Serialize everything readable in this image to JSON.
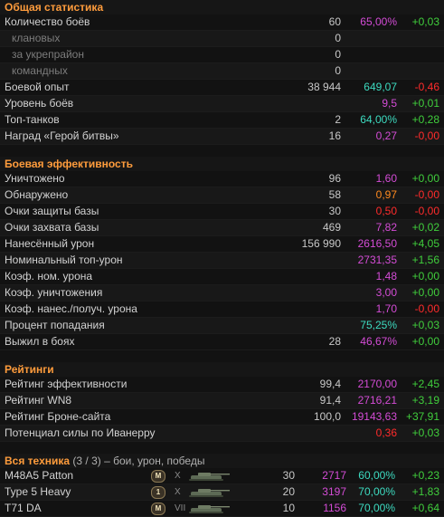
{
  "general": {
    "title": "Общая статистика",
    "rows": [
      {
        "label": "Количество боёв",
        "v1": "60",
        "v2": "65,00%",
        "v2_color": "purple",
        "v3": "+0,03",
        "v3_color": "green"
      },
      {
        "label": "клановых",
        "v1": "0",
        "sub": true
      },
      {
        "label": "за укрепрайон",
        "v1": "0",
        "sub": true
      },
      {
        "label": "командных",
        "v1": "0",
        "sub": true
      },
      {
        "label": "Боевой опыт",
        "v1": "38 944",
        "v2": "649,07",
        "v2_color": "teal",
        "v3": "-0,46",
        "v3_color": "red"
      },
      {
        "label": "Уровень боёв",
        "v2": "9,5",
        "v2_color": "purple",
        "v3": "+0,01",
        "v3_color": "green"
      },
      {
        "label": "Топ-танков",
        "v1": "2",
        "v2": "64,00%",
        "v2_color": "teal",
        "v3": "+0,28",
        "v3_color": "green"
      },
      {
        "label": "Наград «Герой битвы»",
        "v1": "16",
        "v2": "0,27",
        "v2_color": "purple",
        "v3": "-0,00",
        "v3_color": "red"
      }
    ]
  },
  "efficiency": {
    "title": "Боевая эффективность",
    "rows": [
      {
        "label": "Уничтожено",
        "v1": "96",
        "v2": "1,60",
        "v2_color": "purple",
        "v3": "+0,00",
        "v3_color": "green"
      },
      {
        "label": "Обнаружено",
        "v1": "58",
        "v2": "0,97",
        "v2_color": "orange",
        "v3": "-0,00",
        "v3_color": "red"
      },
      {
        "label": "Очки защиты базы",
        "v1": "30",
        "v2": "0,50",
        "v2_color": "red",
        "v3": "-0,00",
        "v3_color": "red"
      },
      {
        "label": "Очки захвата базы",
        "v1": "469",
        "v2": "7,82",
        "v2_color": "purple",
        "v3": "+0,02",
        "v3_color": "green"
      },
      {
        "label": "Нанесённый урон",
        "v1": "156 990",
        "v2": "2616,50",
        "v2_color": "purple",
        "v3": "+4,05",
        "v3_color": "green"
      },
      {
        "label": "Номинальный топ-урон",
        "v2": "2731,35",
        "v2_color": "purple",
        "v3": "+1,56",
        "v3_color": "green"
      },
      {
        "label": "Коэф. ном. урона",
        "v2": "1,48",
        "v2_color": "purple",
        "v3": "+0,00",
        "v3_color": "green"
      },
      {
        "label": "Коэф. уничтожения",
        "v2": "3,00",
        "v2_color": "purple",
        "v3": "+0,00",
        "v3_color": "green"
      },
      {
        "label": "Коэф. нанес./получ. урона",
        "v2": "1,70",
        "v2_color": "purple",
        "v3": "-0,00",
        "v3_color": "red"
      },
      {
        "label": "Процент попадания",
        "v2": "75,25%",
        "v2_color": "teal",
        "v3": "+0,03",
        "v3_color": "green"
      },
      {
        "label": "Выжил в боях",
        "v1": "28",
        "v2": "46,67%",
        "v2_color": "purple",
        "v3": "+0,00",
        "v3_color": "green"
      }
    ]
  },
  "ratings": {
    "title": "Рейтинги",
    "rows": [
      {
        "label": "Рейтинг эффективности",
        "v1": "99,4",
        "v2": "2170,00",
        "v2_color": "purple",
        "v3": "+2,45",
        "v3_color": "green"
      },
      {
        "label": "Рейтинг WN8",
        "v1": "91,4",
        "v2": "2716,21",
        "v2_color": "purple",
        "v3": "+3,19",
        "v3_color": "green"
      },
      {
        "label": "Рейтинг Броне-сайта",
        "v1": "100,0",
        "v2": "19143,63",
        "v2_color": "purple",
        "v3": "+37,91",
        "v3_color": "green"
      },
      {
        "label": "Потенциал силы по Иванерру",
        "v2": "0,36",
        "v2_color": "red",
        "v3": "+0,03",
        "v3_color": "green"
      }
    ]
  },
  "vehicles": {
    "title": "Вся техника",
    "count": "(3 / 3)",
    "subtitle": "– бои, урон, победы",
    "rows": [
      {
        "name": "M48A5 Patton",
        "badge": "M",
        "tier": "X",
        "battles": "30",
        "damage": "2717",
        "winrate": "60,00%",
        "diff": "+0,23"
      },
      {
        "name": "Type 5 Heavy",
        "badge": "1",
        "tier": "X",
        "battles": "20",
        "damage": "3197",
        "winrate": "70,00%",
        "diff": "+1,83"
      },
      {
        "name": "T71 DA",
        "badge": "M",
        "tier": "VII",
        "battles": "10",
        "damage": "1156",
        "winrate": "70,00%",
        "diff": "+0,64"
      }
    ]
  },
  "icons": {
    "mastery_badge": "mastery-badge-icon",
    "tank_silhouette": "tank-silhouette-icon"
  }
}
